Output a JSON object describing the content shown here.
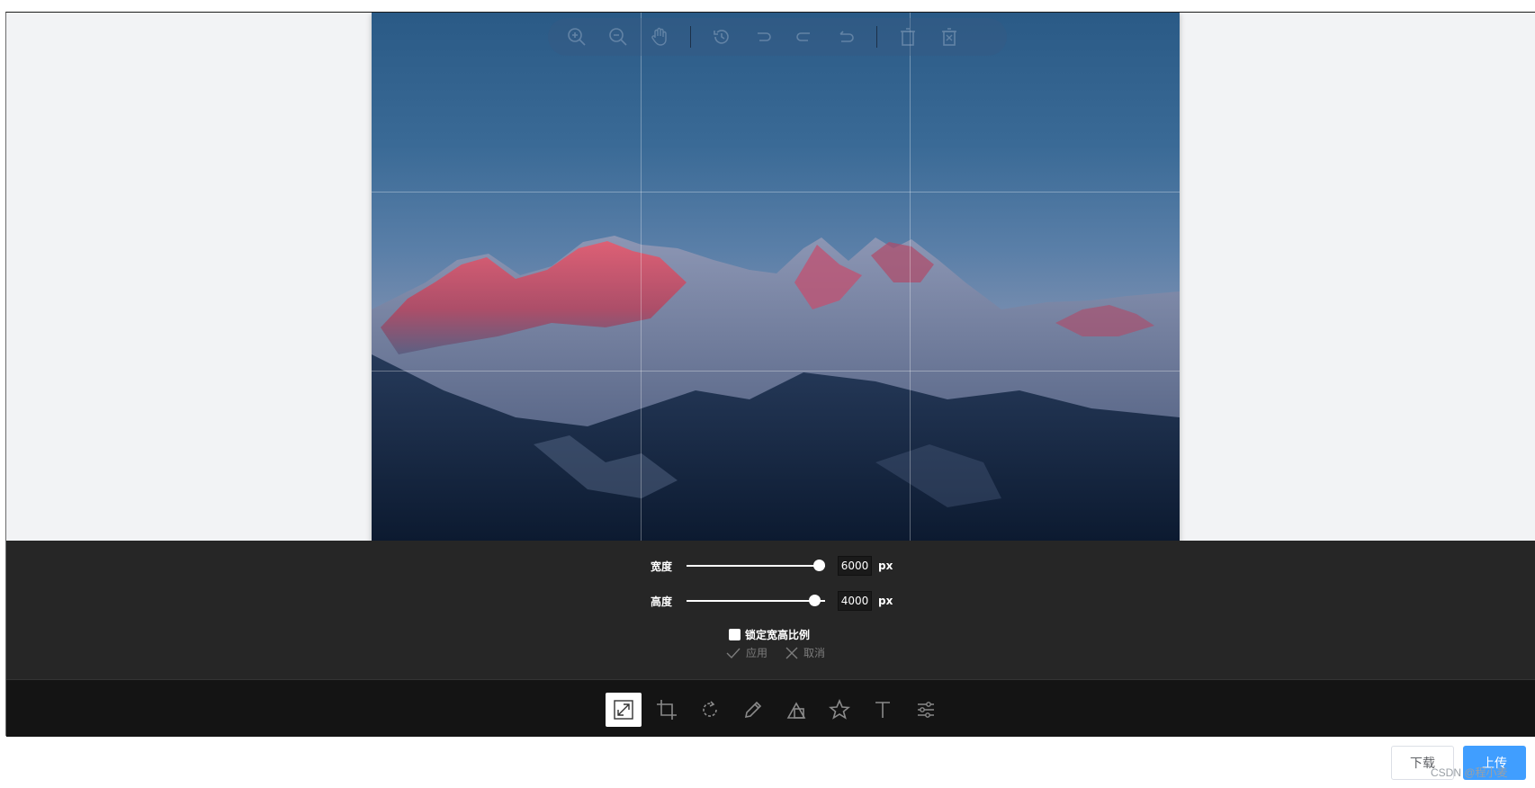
{
  "top_toolbar": {
    "icons": [
      "zoom-in-icon",
      "zoom-out-icon",
      "hand-icon",
      "history-icon",
      "undo-icon",
      "redo-icon",
      "reset-icon",
      "delete-icon",
      "delete-all-icon"
    ]
  },
  "resize_panel": {
    "width_label": "宽度",
    "width_value": "6000",
    "width_unit": "px",
    "height_label": "高度",
    "height_value": "4000",
    "height_unit": "px",
    "lock_label": "锁定宽高比例",
    "lock_checked": false,
    "apply_label": "应用",
    "cancel_label": "取消"
  },
  "bottom_tools": {
    "items": [
      "resize-icon",
      "crop-icon",
      "rotate-icon",
      "draw-icon",
      "shape-icon",
      "icon-tool-icon",
      "text-icon",
      "filter-icon"
    ],
    "active": "resize-icon"
  },
  "footer": {
    "download_label": "下载",
    "upload_label": "上传",
    "watermark": "CSDN @程小麦"
  },
  "colors": {
    "panel_bg": "#262626",
    "toolbar_bg": "#141414",
    "canvas_bg": "#f2f3f5",
    "primary": "#409eff"
  }
}
